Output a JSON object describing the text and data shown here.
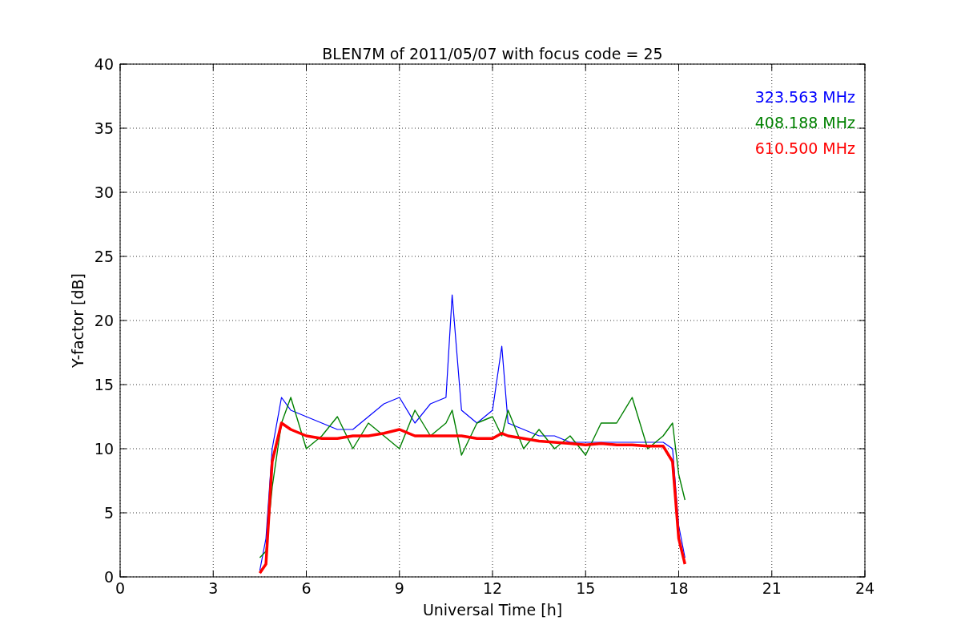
{
  "chart_data": {
    "type": "line",
    "title": "BLEN7M of 2011/05/07 with focus code = 25",
    "xlabel": "Universal Time [h]",
    "ylabel": "Y-factor [dB]",
    "x": [
      4.5,
      4.7,
      4.9,
      5.2,
      5.5,
      6,
      6.5,
      7,
      7.5,
      8,
      8.5,
      9,
      9.5,
      10,
      10.5,
      10.7,
      11,
      11.5,
      12,
      12.3,
      12.5,
      13,
      13.5,
      14,
      14.5,
      15,
      15.5,
      16,
      16.5,
      17,
      17.5,
      17.8,
      18,
      18.2
    ],
    "series": [
      {
        "name": "323.563 MHz",
        "color": "#0000ff",
        "values": [
          0.5,
          3,
          10,
          14,
          13,
          12.5,
          12,
          11.5,
          11.5,
          12.5,
          13.5,
          14,
          12,
          13.5,
          14,
          22,
          13,
          12,
          13,
          18,
          12,
          11.5,
          11,
          11,
          10.5,
          10.5,
          10.5,
          10.5,
          10.5,
          10.5,
          10.5,
          10,
          4,
          1.5
        ]
      },
      {
        "name": "408.188 MHz",
        "color": "#008000",
        "values": [
          1.5,
          2,
          7,
          12,
          14,
          10,
          11,
          12.5,
          10,
          12,
          11,
          10,
          13,
          11,
          12,
          13,
          9.5,
          12,
          12.5,
          11,
          13,
          10,
          11.5,
          10,
          11,
          9.5,
          12,
          12,
          14,
          10,
          11,
          12,
          8,
          6
        ]
      },
      {
        "name": "610.500 MHz",
        "color": "#ff0000",
        "values": [
          0.3,
          1,
          9,
          12,
          11.5,
          11,
          10.8,
          10.8,
          11,
          11,
          11.2,
          11.5,
          11,
          11,
          11,
          11,
          11,
          10.8,
          10.8,
          11.2,
          11,
          10.8,
          10.6,
          10.5,
          10.4,
          10.3,
          10.4,
          10.3,
          10.3,
          10.2,
          10.2,
          9,
          3,
          1
        ]
      }
    ],
    "xlim": [
      0,
      24
    ],
    "ylim": [
      0,
      40
    ],
    "xticks": [
      0,
      3,
      6,
      9,
      12,
      15,
      18,
      21,
      24
    ],
    "yticks": [
      0,
      5,
      10,
      15,
      20,
      25,
      30,
      35,
      40
    ],
    "grid": true
  }
}
